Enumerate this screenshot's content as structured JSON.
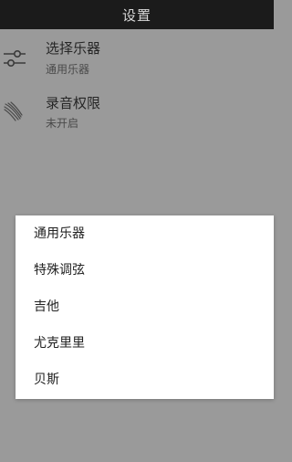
{
  "header": {
    "title": "设置"
  },
  "settings": [
    {
      "icon": "sliders-icon",
      "title": "选择乐器",
      "subtitle": "通用乐器"
    },
    {
      "icon": "microphone-icon",
      "title": "录音权限",
      "subtitle": "未开启"
    }
  ],
  "instrument_dialog": {
    "options": [
      "通用乐器",
      "特殊调弦",
      "吉他",
      "尤克里里",
      "贝斯"
    ]
  },
  "colors": {
    "titlebar_bg": "#1b1b1b",
    "background_dim": "#9a9a9a",
    "dialog_bg": "#ffffff"
  }
}
